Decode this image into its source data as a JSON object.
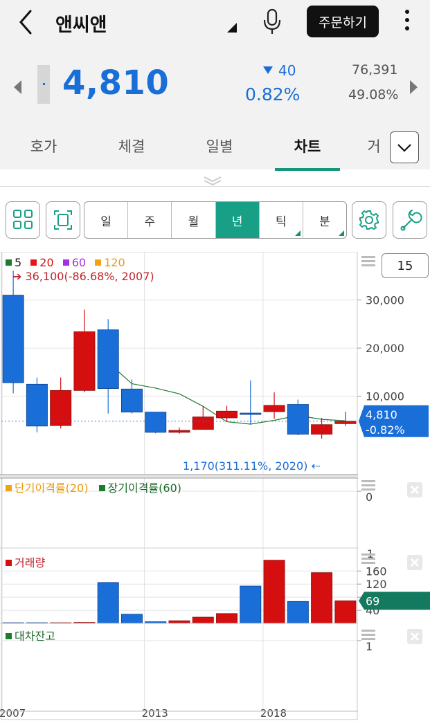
{
  "header": {
    "title": "앤씨앤",
    "order_button": "주문하기",
    "price": "4,810",
    "change": "40",
    "change_pct": "0.82%",
    "volume": "76,391",
    "ratio": "49.08%"
  },
  "tabs": [
    "호가",
    "체결",
    "일별",
    "차트",
    "거"
  ],
  "active_tab": "차트",
  "toolbar": {
    "periods": [
      "일",
      "주",
      "월",
      "년",
      "틱",
      "분"
    ],
    "active_period": "년",
    "count_box": "15"
  },
  "colors": {
    "up": "#d50f0f",
    "down": "#1a6ed8",
    "accent": "#17a085",
    "ma5": "#1e7b2c",
    "ma20": "#e8141b",
    "ma60": "#a530e0",
    "ma120": "#f3a211"
  },
  "icons": [
    "back-icon",
    "mic-icon",
    "more-icon",
    "grid-icon",
    "fullscreen-icon",
    "gear-icon",
    "wrench-icon",
    "chevron-down-icon",
    "close-icon",
    "menu-icon"
  ],
  "chart_data": {
    "type": "candlestick",
    "legend": [
      {
        "label": "5",
        "color": "#1e7b2c"
      },
      {
        "label": "20",
        "color": "#e8141b"
      },
      {
        "label": "60",
        "color": "#a530e0"
      },
      {
        "label": "120",
        "color": "#f3a211"
      }
    ],
    "high_label": "36,100(-86.68%, 2007)",
    "low_label": "1,170(311.11%, 2020)",
    "current_label_price": "4,810",
    "current_label_pct": "-0.82%",
    "price_ticks": [
      "30,000",
      "20,000",
      "10,000"
    ],
    "price_tick_values": [
      30000,
      20000,
      10000
    ],
    "ylim": [
      -6000,
      40000
    ],
    "x_tick_labels": [
      "2007",
      "2013",
      "2018"
    ],
    "x_tick_years": [
      2007,
      2013,
      2018
    ],
    "candles": [
      {
        "year": 2007,
        "open": 31000,
        "close": 12800,
        "high": 36100,
        "low": 10600
      },
      {
        "year": 2008,
        "open": 12500,
        "close": 3800,
        "high": 13900,
        "low": 2500
      },
      {
        "year": 2009,
        "open": 3900,
        "close": 11200,
        "high": 13900,
        "low": 3300
      },
      {
        "year": 2010,
        "open": 11200,
        "close": 23400,
        "high": 28000,
        "low": 10800
      },
      {
        "year": 2011,
        "open": 23800,
        "close": 11600,
        "high": 26000,
        "low": 6400
      },
      {
        "year": 2012,
        "open": 11500,
        "close": 6700,
        "high": 13500,
        "low": 6400
      },
      {
        "year": 2013,
        "open": 6700,
        "close": 2500,
        "high": 6700,
        "low": 2300
      },
      {
        "year": 2014,
        "open": 2500,
        "close": 2900,
        "high": 3500,
        "low": 2200
      },
      {
        "year": 2015,
        "open": 3100,
        "close": 5700,
        "high": 8000,
        "low": 3100
      },
      {
        "year": 2016,
        "open": 5500,
        "close": 6900,
        "high": 8000,
        "low": 4700
      },
      {
        "year": 2017,
        "open": 6500,
        "close": 6300,
        "high": 13300,
        "low": 4100
      },
      {
        "year": 2018,
        "open": 6800,
        "close": 8100,
        "high": 10800,
        "low": 5300
      },
      {
        "year": 2019,
        "open": 8300,
        "close": 2100,
        "high": 9300,
        "low": 1900
      },
      {
        "year": 2020,
        "open": 2100,
        "close": 4100,
        "high": 5500,
        "low": 1170
      },
      {
        "year": 2021,
        "open": 4300,
        "close": 4810,
        "high": 6800,
        "low": 3800
      }
    ],
    "ma5_line": [
      null,
      null,
      null,
      null,
      17000,
      12600,
      11700,
      10500,
      7900,
      4700,
      4200,
      5000,
      6000,
      5200,
      4900
    ],
    "indicator_panel": {
      "legend": [
        {
          "label": "단기이격률(20)",
          "color": "#f3a211"
        },
        {
          "label": "장기이격률(60)",
          "color": "#1e7b2c"
        }
      ],
      "ticks": [
        "0",
        "-1"
      ]
    },
    "volume_panel": {
      "legend": [
        {
          "label": "거래량",
          "color": "#d50f0f"
        }
      ],
      "ticks": [
        "160",
        "120",
        "80",
        "40"
      ],
      "tick_values": [
        160,
        120,
        80,
        40
      ],
      "ylim": [
        0,
        205
      ],
      "current_label": "69",
      "values": [
        2,
        2,
        2,
        3,
        125,
        28,
        5,
        8,
        19,
        30,
        114,
        193,
        67,
        155,
        69
      ]
    },
    "short_panel": {
      "legend": [
        {
          "label": "대차잔고",
          "color": "#1e7b2c"
        }
      ],
      "ticks": [
        "1"
      ]
    }
  }
}
